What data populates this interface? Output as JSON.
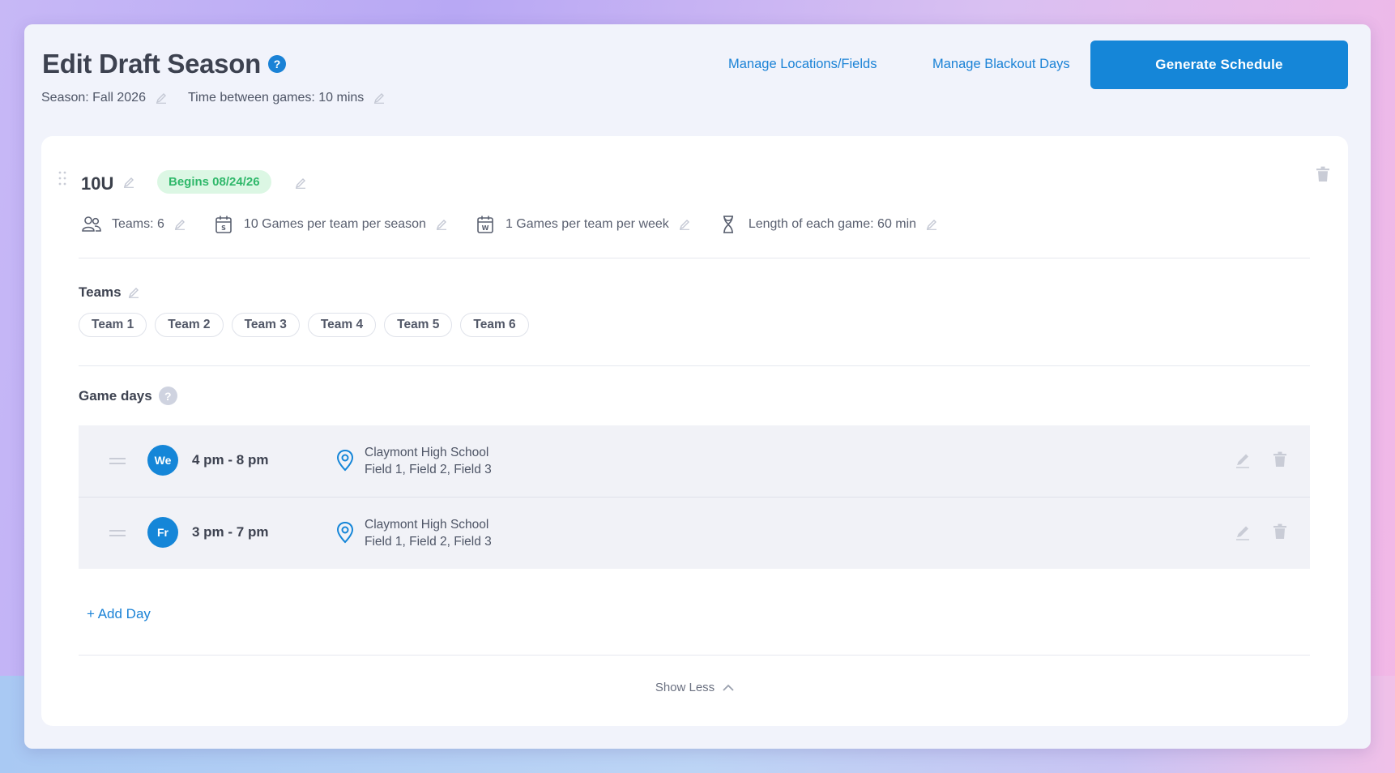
{
  "header": {
    "title": "Edit Draft Season",
    "help_icon": "?",
    "season_label": "Season: Fall 2026",
    "time_between_label": "Time between games: 10 mins",
    "links": [
      "Manage Locations/Fields",
      "Manage Blackout Days"
    ],
    "generate_label": "Generate Schedule"
  },
  "group": {
    "name": "10U",
    "begins_badge": "Begins 08/24/26",
    "stats": {
      "teams": "Teams: 6",
      "games_per_season": "10 Games per team per season",
      "games_per_week": "1 Games per team per week",
      "game_length": "Length of each game: 60 min"
    },
    "teams_label": "Teams",
    "teams": [
      "Team 1",
      "Team 2",
      "Team 3",
      "Team 4",
      "Team 5",
      "Team 6"
    ],
    "game_days_label": "Game days",
    "game_days_help": "?",
    "game_days": [
      {
        "day": "We",
        "time": "4 pm - 8 pm",
        "school": "Claymont High School",
        "fields": "Field 1, Field 2, Field 3"
      },
      {
        "day": "Fr",
        "time": "3 pm - 7 pm",
        "school": "Claymont High School",
        "fields": "Field 1, Field 2, Field 3"
      }
    ],
    "add_day_label": "+ Add Day",
    "show_less_label": "Show Less"
  },
  "colors": {
    "accent": "#1586d8",
    "badge_bg": "#dcf7e4",
    "badge_text": "#2fb86a"
  },
  "icons": {
    "title_help": "help-circle-icon",
    "edit": "pencil-icon",
    "delete": "trash-icon",
    "teams": "users-icon",
    "season_calendar": "calendar-season-icon",
    "week_calendar": "calendar-week-icon",
    "duration": "hourglass-icon",
    "location": "map-pin-icon",
    "drag": "drag-handle-icon",
    "collapse": "chevron-up-icon"
  }
}
